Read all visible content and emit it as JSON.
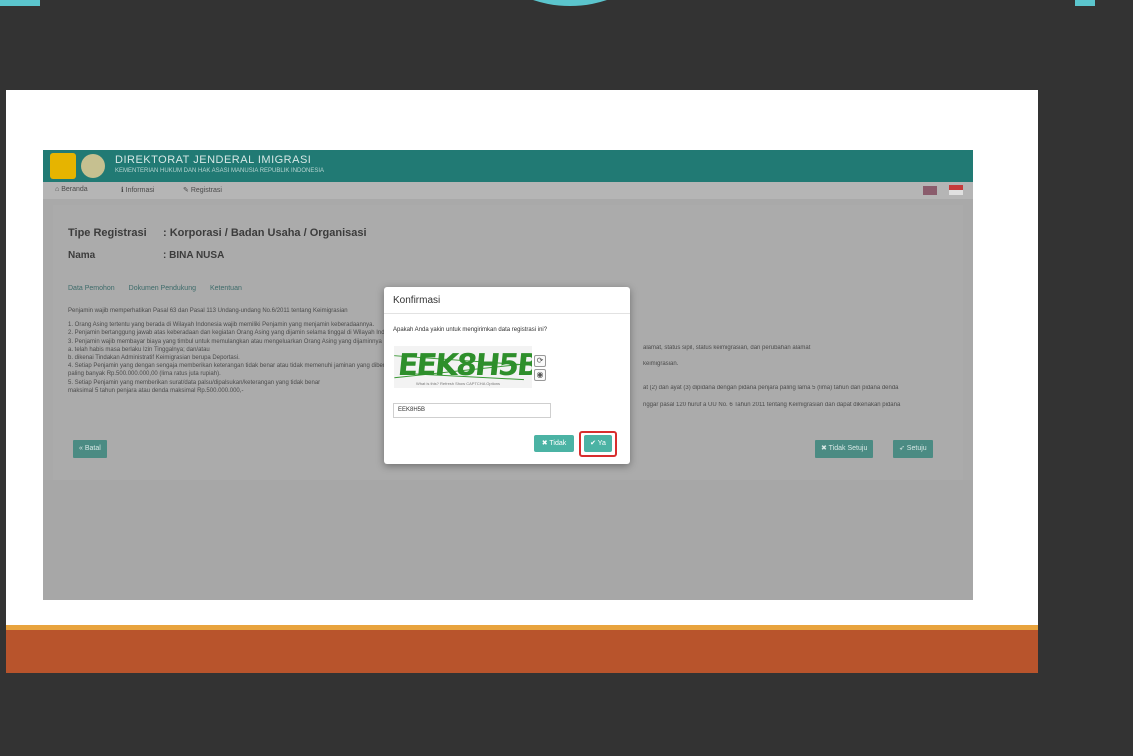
{
  "app": {
    "title": "DIREKTORAT JENDERAL IMIGRASI",
    "subtitle": "KEMENTERIAN HUKUM DAN HAK ASASI MANUSIA REPUBLIK INDONESIA"
  },
  "nav": {
    "items": [
      {
        "icon": "home-icon",
        "glyph": "⌂",
        "label": "Beranda"
      },
      {
        "icon": "info-icon",
        "glyph": "ℹ",
        "label": "Informasi"
      },
      {
        "icon": "pencil-icon",
        "glyph": "✎",
        "label": "Registrasi"
      }
    ]
  },
  "registration": {
    "type_label": "Tipe Registrasi",
    "type_value": ": Korporasi / Badan Usaha / Organisasi",
    "name_label": "Nama",
    "name_value": ": BINA NUSA"
  },
  "tabs": [
    "Data Pemohon",
    "Dokumen Pendukung",
    "Ketentuan"
  ],
  "body_lines": [
    "Penjamin wajib memperhatikan Pasal 63 dan Pasal 113 Undang-undang No.6/2011 tentang Keimigrasian",
    "1. Orang Asing tertentu yang berada di Wilayah Indonesia wajib memiliki Penjamin yang menjamin keberadaannya.",
    "2. Penjamin bertanggung jawab atas keberadaan dan kegiatan Orang Asing yang dijamin selama tinggal di Wilayah Indonesia",
    "3. Penjamin wajib membayar biaya yang timbul untuk memulangkan atau mengeluarkan Orang Asing yang dijaminnya",
    "   a. telah habis masa berlaku Izin Tinggalnya; dan/atau",
    "   b. dikenai Tindakan Administratif Keimigrasian berupa Deportasi.",
    "4. Setiap Penjamin yang dengan sengaja memberikan keterangan tidak benar atau tidak memenuhi jaminan yang diberikannya",
    "   paling banyak Rp.500.000.000,00 (lima ratus juta rupiah).",
    "5. Setiap Penjamin yang memberikan surat/data palsu/dipalsukan/keterangan yang tidak benar",
    "   maksimal 5 tahun penjara atau denda maksimal Rp.500.000.000,-"
  ],
  "right_lines": [
    "alamat, status sipil, status keimigrasian, dan perubahan alamat",
    "keimigrasian.",
    "at (2) dan ayat (3) dipidana dengan pidana penjara paling lama 5 (lima) tahun dan pidana denda",
    "nggar pasal 120 huruf a UU No. 6 Tahun 2011 tentang Keimigrasian dan dapat dikenakan pidana"
  ],
  "buttons": {
    "back": "« Batal",
    "disagree": "✖ Tidak Setuju",
    "agree": "➶ Setuju"
  },
  "modal": {
    "title": "Konfirmasi",
    "question": "Apakah Anda yakin untuk mengirimkan data registrasi ini?",
    "captcha_text": "EEK8H5B",
    "captcha_hint": "What is this?  Refresh  Show CAPTCHA Options",
    "captcha_input_value": "EEK8H5B",
    "refresh_glyph": "⟳",
    "audio_glyph": "◉",
    "cancel_label": "✖ Tidak",
    "confirm_label": "✔ Ya"
  },
  "colors": {
    "header": "#217a74",
    "accent": "#4bb3a4",
    "highlight": "#d82e2e",
    "orange_band": "#b8542c"
  }
}
